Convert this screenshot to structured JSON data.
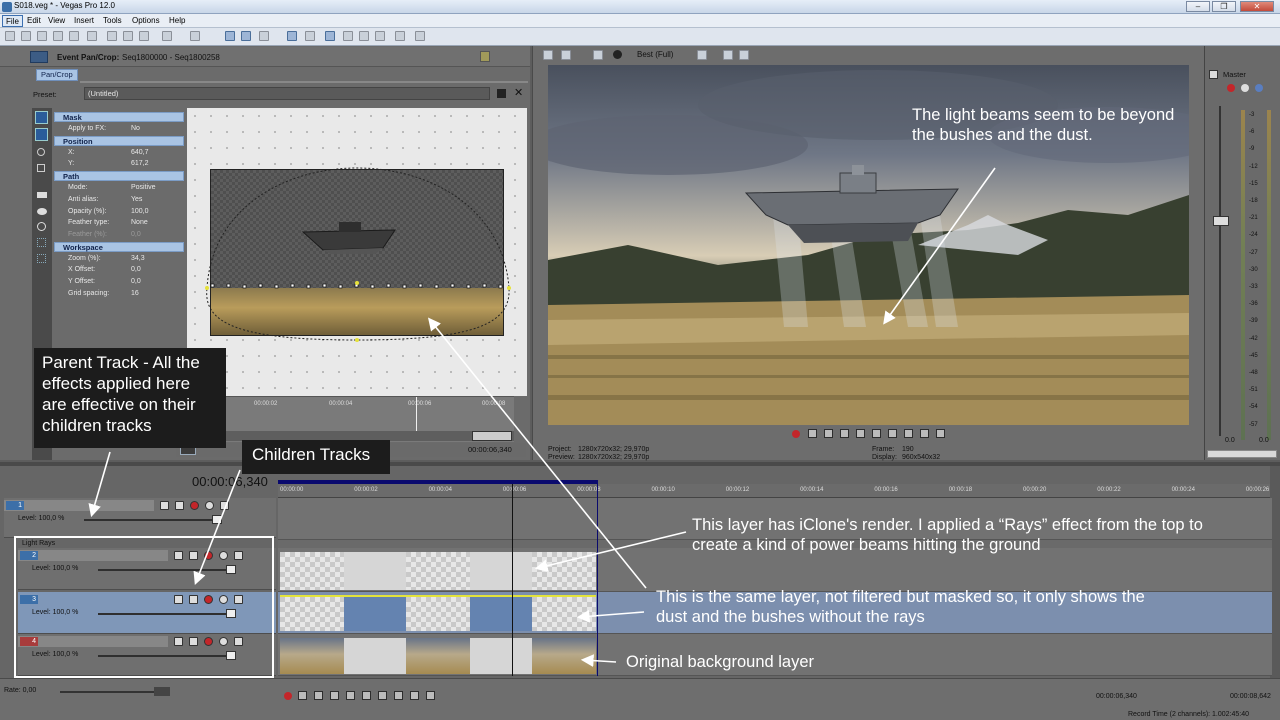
{
  "window": {
    "title": "S018.veg * - Vegas Pro 12.0",
    "controls": [
      "–",
      "❐",
      "✕"
    ]
  },
  "menu": [
    "File",
    "Edit",
    "View",
    "Insert",
    "Tools",
    "Options",
    "Help"
  ],
  "event_panel": {
    "title": "Event Pan/Crop:",
    "seq": "Seq1800000 - Seq1800258",
    "tab": "Pan/Crop",
    "preset_label": "Preset:",
    "preset_value": "(Untitled)",
    "groups": [
      {
        "name": "Mask",
        "rows": [
          {
            "k": "Apply to FX:",
            "v": "No"
          }
        ]
      },
      {
        "name": "Position",
        "rows": [
          {
            "k": "X:",
            "v": "640,7"
          },
          {
            "k": "Y:",
            "v": "617,2"
          }
        ]
      },
      {
        "name": "Path",
        "rows": [
          {
            "k": "Mode:",
            "v": "Positive"
          },
          {
            "k": "Anti alias:",
            "v": "Yes"
          },
          {
            "k": "Opacity (%):",
            "v": "100,0"
          },
          {
            "k": "Feather type:",
            "v": "None"
          },
          {
            "k": "Feather (%):",
            "v": "0,0"
          }
        ]
      },
      {
        "name": "Workspace",
        "rows": [
          {
            "k": "Zoom (%):",
            "v": "34,3"
          },
          {
            "k": "X Offset:",
            "v": "0,0"
          },
          {
            "k": "Y Offset:",
            "v": "0,0"
          },
          {
            "k": "Grid spacing:",
            "v": "16"
          }
        ]
      }
    ],
    "ruler": [
      "00:00:02",
      "00:00:04",
      "00:00:06",
      "00:00:08"
    ],
    "time": "00:00:06,340"
  },
  "preview": {
    "quality": "Best (Full)",
    "project_label": "Project:",
    "project_value": "1280x720x32; 29,970p",
    "preview_label": "Preview:",
    "preview_value": "1280x720x32; 29,970p",
    "frame_label": "Frame:",
    "frame_value": "190",
    "display_label": "Display:",
    "display_value": "960x540x32"
  },
  "mixer": {
    "title": "Master",
    "scale": [
      "-3",
      "-6",
      "-9",
      "-12",
      "-15",
      "-18",
      "-21",
      "-24",
      "-27",
      "-30",
      "-33",
      "-36",
      "-39",
      "-42",
      "-45",
      "-48",
      "-51",
      "-54",
      "-57"
    ],
    "out_left": "0.0",
    "out_right": "0.0"
  },
  "timeline": {
    "timecode": "00:00:06,340",
    "ruler": [
      "00:00:00",
      "00:00:02",
      "00:00:04",
      "00:00:06",
      "00:00:08",
      "00:00:10",
      "00:00:12",
      "00:00:14",
      "00:00:16",
      "00:00:18",
      "00:00:20",
      "00:00:22",
      "00:00:24",
      "00:00:26"
    ],
    "tracks": [
      {
        "num": "1",
        "level": "Level: 100,0 %"
      },
      {
        "num": "2",
        "level": "Level: 100,0 %"
      },
      {
        "num": "3",
        "level": "Level: 100,0 %"
      },
      {
        "num": "4",
        "level": "Level: 100,0 %"
      }
    ],
    "group_name": "Light Rays",
    "rate": "Rate: 0,00",
    "bottom_time": "00:00:06,340",
    "bottom_end": "00:00:08,642",
    "record_time": "Record Time (2 channels): 1.002:45:40"
  },
  "annotations": {
    "light_beams": "The light beams seem to be beyond the bushes and the dust.",
    "parent_track": "Parent Track - All the effects applied here are effective on their children tracks",
    "children": "Children Tracks",
    "iclone": "This layer has iClone's render. I applied a “Rays” effect from the top to create a kind of power beams hitting the ground",
    "same_layer": "This is the same layer, not filtered but masked so, it only shows the dust and the bushes without the rays",
    "original": "Original background layer"
  }
}
